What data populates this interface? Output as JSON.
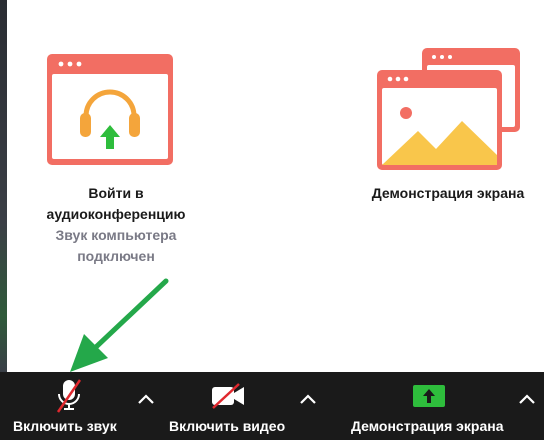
{
  "join_audio": {
    "title": "Войти в аудиоконференцию",
    "status": "Звук компьютера подключен"
  },
  "screen_share_panel": {
    "title": "Демонстрация экрана"
  },
  "toolbar": {
    "unmute_label": "Включить звук",
    "start_video_label": "Включить видео",
    "share_screen_label": "Демонстрация экрана"
  },
  "colors": {
    "card_red": "#f26e63",
    "headphone_orange": "#f4a53b",
    "arrow_green": "#2ebd3c",
    "mountain_yellow": "#f9c64b",
    "muted_red": "#e0282e",
    "toolbar_bg": "#1a1a1a"
  }
}
